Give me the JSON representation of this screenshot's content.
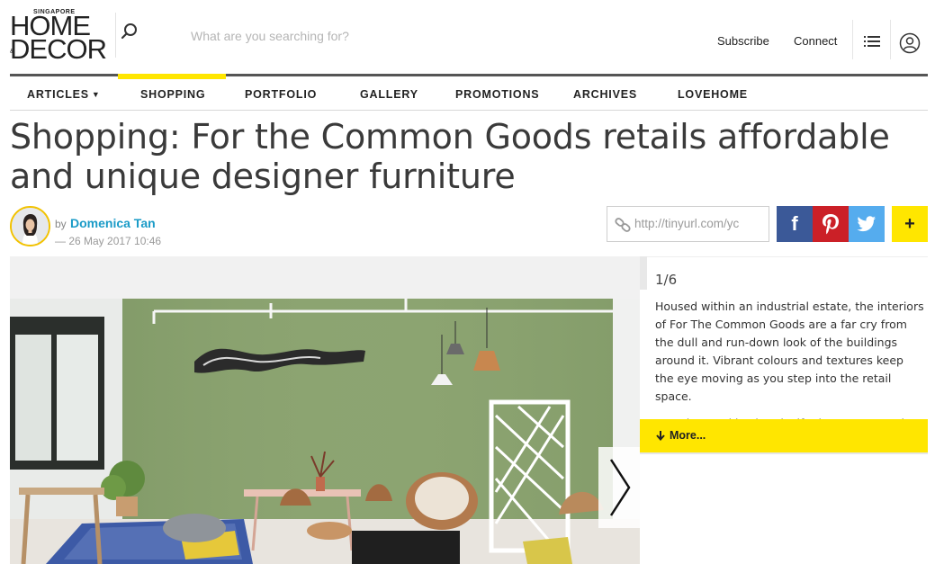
{
  "header": {
    "logo_small": "SINGAPORE",
    "logo_line1": "HOME",
    "logo_amp": "&",
    "logo_line2": "DECOR",
    "search_placeholder": "What are you searching for?",
    "subscribe_label": "Subscribe",
    "connect_label": "Connect"
  },
  "nav": {
    "items": [
      {
        "label": "ARTICLES"
      },
      {
        "label": "SHOPPING"
      },
      {
        "label": "PORTFOLIO"
      },
      {
        "label": "GALLERY"
      },
      {
        "label": "PROMOTIONS"
      },
      {
        "label": "ARCHIVES"
      },
      {
        "label": "LOVEHOME"
      }
    ],
    "active": "SHOPPING"
  },
  "article": {
    "title": "Shopping: For the Common Goods retails affordable and unique designer furniture",
    "by_label": "by",
    "author": "Domenica Tan",
    "date": "— 26 May 2017 10:46"
  },
  "share": {
    "short_url": "http://tinyurl.com/yc",
    "facebook_label": "f",
    "plus_label": "+"
  },
  "gallery": {
    "counter": "1/6",
    "caption_p1": "Housed within an industrial estate, the interiors of For The Common Goods are a far cry from the dull and run-down look of the buildings around it. Vibrant colours and textures keep the eye moving as you step into the retail space.",
    "caption_p2": "Founders and husband-wife duo Tommy and",
    "more_label": "More..."
  },
  "colors": {
    "accent_yellow": "#ffe600",
    "author_blue": "#1a9bc7",
    "facebook": "#3b5998",
    "pinterest": "#cb2027",
    "twitter": "#55acee"
  }
}
